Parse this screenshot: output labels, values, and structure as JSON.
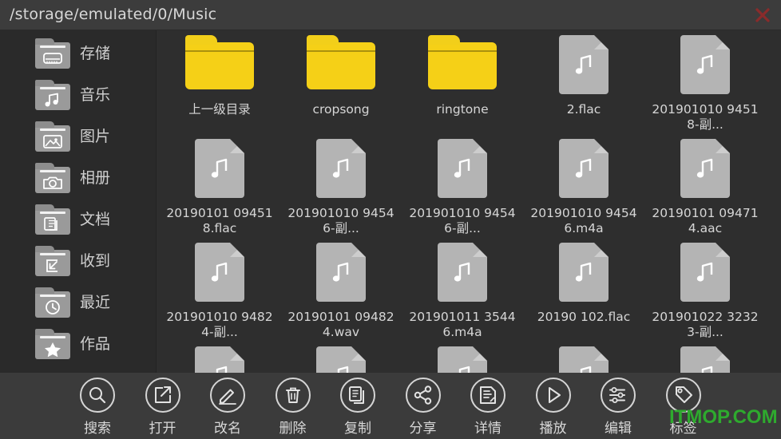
{
  "titlebar": {
    "path": "/storage/emulated/0/Music",
    "close_icon": "close-x-icon"
  },
  "sidebar": {
    "items": [
      {
        "label": "存储",
        "icon": "storage-drive-icon"
      },
      {
        "label": "音乐",
        "icon": "music-note-icon"
      },
      {
        "label": "图片",
        "icon": "picture-icon"
      },
      {
        "label": "相册",
        "icon": "camera-icon"
      },
      {
        "label": "文档",
        "icon": "documents-icon"
      },
      {
        "label": "收到",
        "icon": "inbox-arrow-icon"
      },
      {
        "label": "最近",
        "icon": "clock-icon"
      },
      {
        "label": "作品",
        "icon": "star-icon"
      }
    ]
  },
  "files": [
    {
      "name": "上一级目录",
      "type": "folder"
    },
    {
      "name": "cropsong",
      "type": "folder"
    },
    {
      "name": "ringtone",
      "type": "folder"
    },
    {
      "name": "2.flac",
      "type": "audio"
    },
    {
      "name": "201901010 94518-副...",
      "type": "audio"
    },
    {
      "name": "20190101 094518.flac",
      "type": "audio"
    },
    {
      "name": "201901010 94546-副...",
      "type": "audio"
    },
    {
      "name": "201901010 94546-副...",
      "type": "audio"
    },
    {
      "name": "201901010 94546.m4a",
      "type": "audio"
    },
    {
      "name": "20190101 094714.aac",
      "type": "audio"
    },
    {
      "name": "201901010 94824-副...",
      "type": "audio"
    },
    {
      "name": "20190101 094824.wav",
      "type": "audio"
    },
    {
      "name": "201901011 35446.m4a",
      "type": "audio"
    },
    {
      "name": "20190 102.flac",
      "type": "audio"
    },
    {
      "name": "201901022 32323-副...",
      "type": "audio"
    },
    {
      "name": "",
      "type": "audio"
    },
    {
      "name": "",
      "type": "audio"
    },
    {
      "name": "",
      "type": "audio"
    },
    {
      "name": "",
      "type": "audio"
    },
    {
      "name": "",
      "type": "audio"
    }
  ],
  "toolbar": {
    "items": [
      {
        "label": "搜索",
        "icon": "search-icon"
      },
      {
        "label": "打开",
        "icon": "open-external-icon"
      },
      {
        "label": "改名",
        "icon": "pencil-rename-icon"
      },
      {
        "label": "删除",
        "icon": "trash-icon"
      },
      {
        "label": "复制",
        "icon": "copy-icon"
      },
      {
        "label": "分享",
        "icon": "share-icon"
      },
      {
        "label": "详情",
        "icon": "details-icon"
      },
      {
        "label": "播放",
        "icon": "play-icon"
      },
      {
        "label": "编辑",
        "icon": "sliders-edit-icon"
      },
      {
        "label": "标签",
        "icon": "tag-icon"
      }
    ]
  },
  "watermark": {
    "text": "ITMOP.COM",
    "color": "#2eaa2e"
  },
  "colors": {
    "window_bg": "#2e2e2e",
    "titlebar_bg": "#3c3c3c",
    "sidebar_bg": "#2a2a2a",
    "toolbar_bg": "#3b3b3b",
    "folder_yellow": "#f5d017",
    "file_gray": "#b4b4b4",
    "text": "#d6d6d6"
  }
}
